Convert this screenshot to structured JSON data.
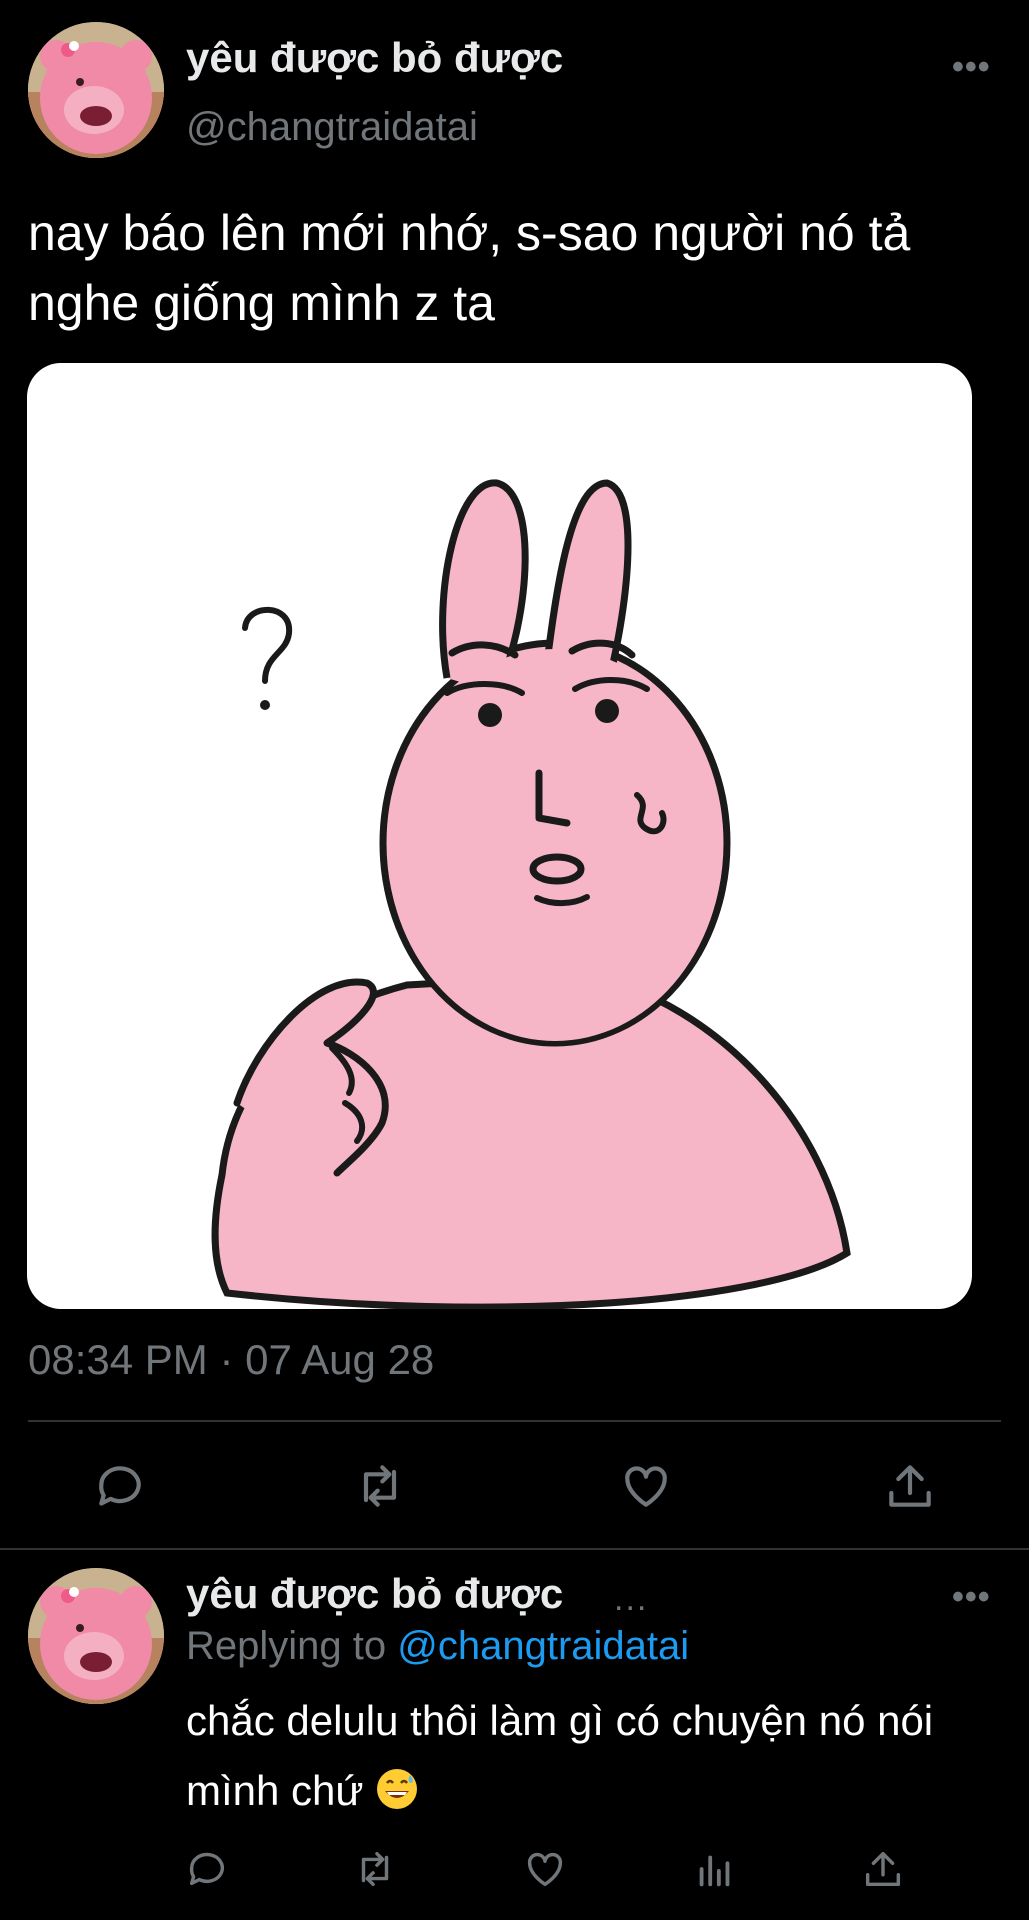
{
  "tweet": {
    "display_name": "yêu được bỏ được",
    "handle": "@changtraidatai",
    "more_icon": "more-horizontal-icon",
    "text": "nay báo lên mới nhớ, s-sao người nó tả nghe giống mình z ta",
    "image_description": "pink bunny cartoon pointing at itself with a question mark",
    "timestamp": "08:34 PM · 07 Aug 28",
    "actions": [
      "reply-icon",
      "retweet-icon",
      "like-icon",
      "share-icon"
    ]
  },
  "reply": {
    "display_name": "yêu được bỏ được",
    "name_ellipsis": "...",
    "replying_prefix": "Replying to",
    "replying_to": "@changtraidatai",
    "text": "chắc delulu thôi làm gì có chuyện nó nói mình chứ",
    "emoji": "grinning-face-with-sweat-emoji",
    "actions": [
      "reply-icon",
      "retweet-icon",
      "like-icon",
      "analytics-icon",
      "share-icon"
    ]
  },
  "colors": {
    "background": "#000000",
    "primary_text": "#ffffff",
    "secondary_text": "#71767b",
    "accent": "#1d9bf0",
    "divider": "#2f3336",
    "bunny_pink": "#f7b6c8"
  }
}
